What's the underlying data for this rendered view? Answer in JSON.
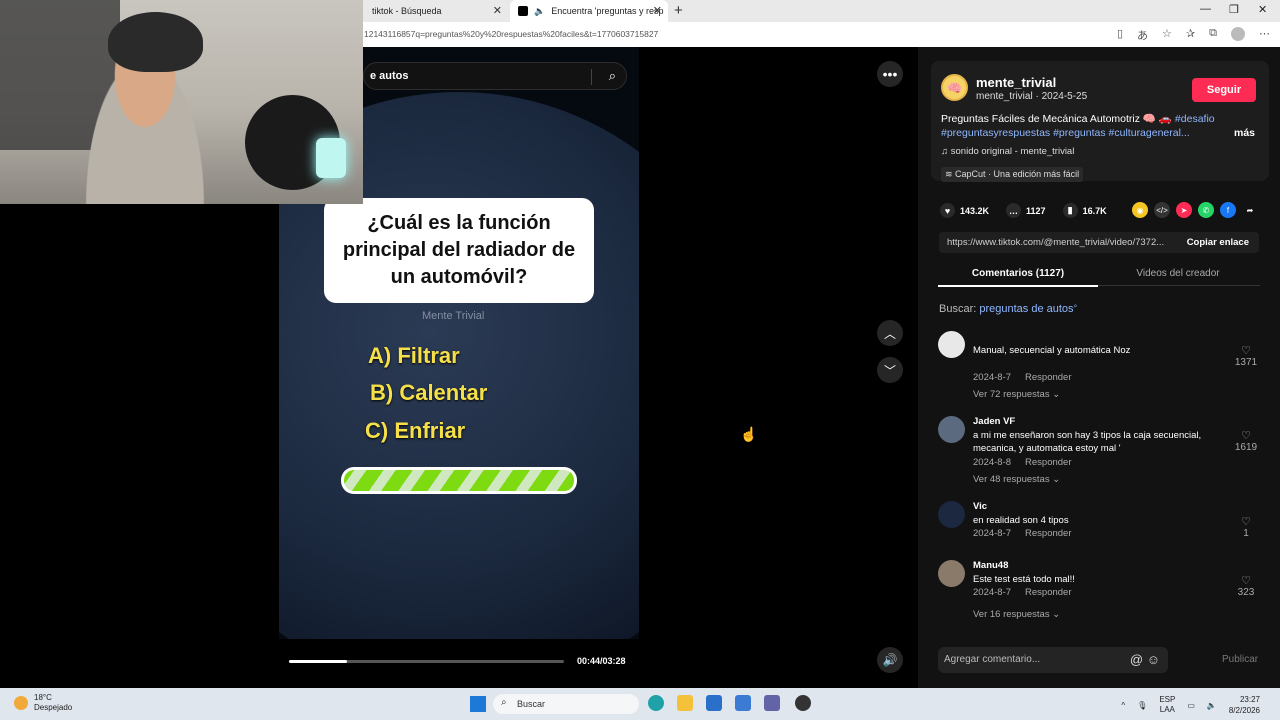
{
  "browser": {
    "tabs": [
      {
        "title": "tiktok - Búsqueda"
      },
      {
        "title": "Encuentra 'preguntas y resp"
      }
    ],
    "url": "12143116857q=preguntas%20y%20respuestas%20faciles&t=1770603715827"
  },
  "video": {
    "search_text": "e autos",
    "question": "¿Cuál es la función principal del radiador de un automóvil?",
    "watermark": "Mente Trivial",
    "options": [
      "A) Filtrar",
      "B) Calentar",
      "C) Enfriar"
    ],
    "time": "00:44/03:28",
    "progress": 0.21,
    "timer_fill": 1.0
  },
  "post": {
    "username": "mente_trivial",
    "subline": "mente_trivial · 2024-5-25",
    "follow_label": "Seguir",
    "description": "Preguntas Fáciles de Mecánica Automotriz 🧠 🚗",
    "hashtags": [
      "#desafio",
      "#preguntasyrespuestas",
      "#preguntas",
      "#culturageneral..."
    ],
    "more_label": "más",
    "music": "sonido original - mente_trivial",
    "capcut": "CapCut · Una edición más fácil",
    "likes": "143.2K",
    "comments": "1127",
    "saves": "16.7K",
    "link": "https://www.tiktok.com/@mente_trivial/video/7372...",
    "copy_label": "Copiar enlace"
  },
  "tabs": {
    "comments": "Comentarios (1127)",
    "creator": "Videos del creador"
  },
  "comment_search": {
    "label": "Buscar:",
    "query": "preguntas de autos"
  },
  "comments": [
    {
      "name": "",
      "text": "Manual, secuencial y automática Noz",
      "date": "2024-8-7",
      "reply": "Responder",
      "more": "Ver 72 respuestas",
      "likes": "1371"
    },
    {
      "name": "Jaden VF",
      "text": "a mi me enseñaron son hay 3 tipos la caja secuencial, mecanica, y automatica estoy mal '",
      "date": "2024-8-8",
      "reply": "Responder",
      "more": "Ver 48 respuestas",
      "likes": "1619"
    },
    {
      "name": "Vic",
      "text": "en realidad son 4 tipos",
      "date": "2024-8-7",
      "reply": "Responder",
      "more": "",
      "likes": "1"
    },
    {
      "name": "Manu48",
      "text": "Este test está todo mal!!",
      "date": "2024-8-7",
      "reply": "Responder",
      "more": "Ver 16 respuestas",
      "likes": "323"
    }
  ],
  "add_comment": {
    "placeholder": "Agregar comentario...",
    "publish": "Publicar"
  },
  "taskbar": {
    "temp": "18°C",
    "weather": "Despejado",
    "search": "Buscar",
    "lang1": "ESP",
    "lang2": "LAA",
    "time": "23:27",
    "date": "8/2/2026"
  }
}
